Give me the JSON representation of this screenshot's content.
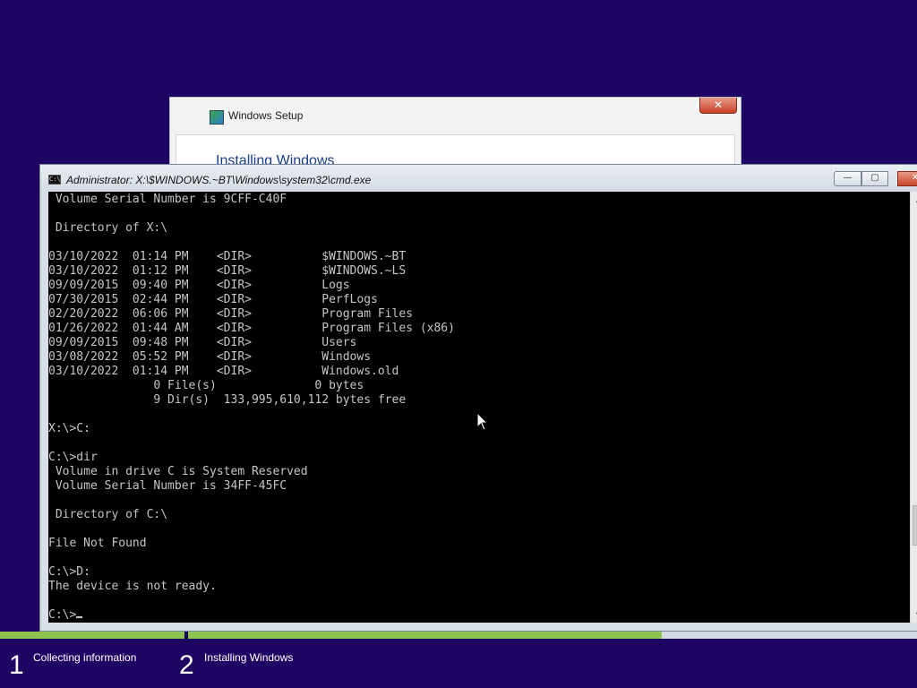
{
  "setup_window": {
    "title": "Windows Setup",
    "heading": "Installing Windows",
    "close_glyph": "✕"
  },
  "cmd_window": {
    "title": "Administrator: X:\\$WINDOWS.~BT\\Windows\\system32\\cmd.exe",
    "icon_label": "C:\\",
    "minimize_glyph": "—",
    "maximize_glyph": "▢",
    "close_glyph": "✕"
  },
  "console_lines": [
    " Volume Serial Number is 9CFF-C40F",
    "",
    " Directory of X:\\",
    "",
    "03/10/2022  01:14 PM    <DIR>          $WINDOWS.~BT",
    "03/10/2022  01:12 PM    <DIR>          $WINDOWS.~LS",
    "09/09/2015  09:40 PM    <DIR>          Logs",
    "07/30/2015  02:44 PM    <DIR>          PerfLogs",
    "02/20/2022  06:06 PM    <DIR>          Program Files",
    "01/26/2022  01:44 AM    <DIR>          Program Files (x86)",
    "09/09/2015  09:48 PM    <DIR>          Users",
    "03/08/2022  05:52 PM    <DIR>          Windows",
    "03/10/2022  01:14 PM    <DIR>          Windows.old",
    "               0 File(s)              0 bytes",
    "               9 Dir(s)  133,995,610,112 bytes free",
    "",
    "X:\\>C:",
    "",
    "C:\\>dir",
    " Volume in drive C is System Reserved",
    " Volume Serial Number is 34FF-45FC",
    "",
    " Directory of C:\\",
    "",
    "File Not Found",
    "",
    "C:\\>D:",
    "The device is not ready.",
    "",
    "C:\\>"
  ],
  "progress": {
    "steps": [
      {
        "number": "1",
        "label": "Collecting information"
      },
      {
        "number": "2",
        "label": "Installing Windows"
      }
    ],
    "step2_fraction": 0.65
  },
  "colors": {
    "background": "#1f0563",
    "progress_fill": "#8ec44e",
    "console_text": "#c6c6c6"
  },
  "icons": {
    "setup": "setup-icon",
    "cmd": "cmd-icon",
    "pointer": "mouse-pointer-icon"
  }
}
